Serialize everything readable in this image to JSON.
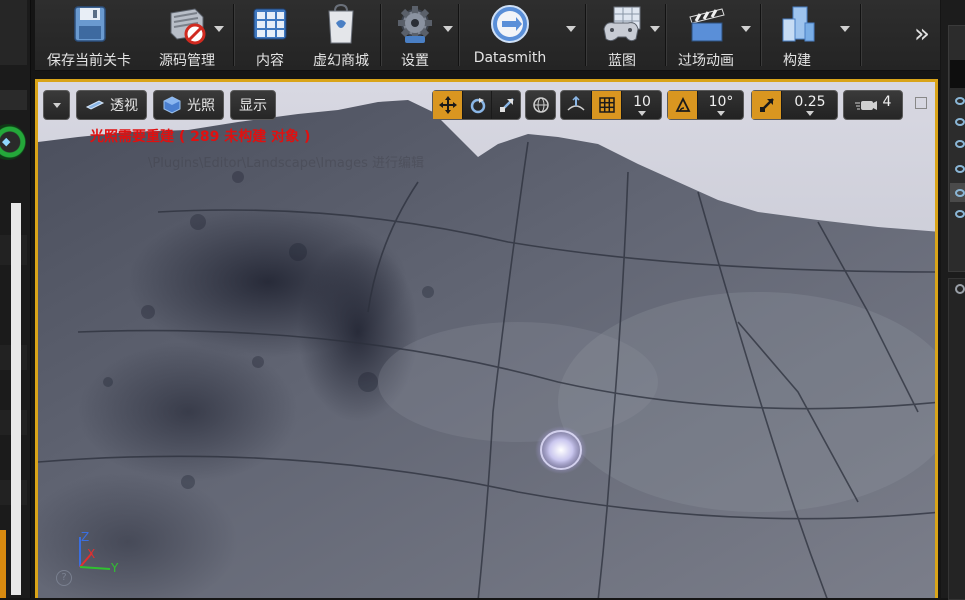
{
  "toolbar": {
    "items": [
      {
        "label": "保存当前关卡",
        "icon": "save-icon"
      },
      {
        "label": "源码管理",
        "icon": "source-control-icon"
      },
      {
        "label": "内容",
        "icon": "content-icon"
      },
      {
        "label": "虚幻商城",
        "icon": "marketplace-icon"
      },
      {
        "label": "设置",
        "icon": "settings-icon"
      },
      {
        "label": "Datasmith",
        "icon": "datasmith-icon"
      },
      {
        "label": "蓝图",
        "icon": "blueprint-icon"
      },
      {
        "label": "过场动画",
        "icon": "cinematics-icon"
      },
      {
        "label": "构建",
        "icon": "build-icon"
      }
    ],
    "more_icon": "double-chevron-right-icon",
    "more_glyph": "»"
  },
  "viewport": {
    "perspective_label": "透视",
    "lighting_label": "光照",
    "show_label": "显示",
    "grid_snap_value": "10",
    "rotation_snap_value": "10°",
    "scale_snap_value": "0.25",
    "camera_speed_value": "4",
    "warning_text": "光照需要重建 ( 289 未构建 对象 )",
    "ghost_text": "\\Plugins\\Editor\\Landscape\\Images 进行编辑",
    "axis_labels": {
      "z": "Z",
      "x": "X",
      "y": "Y"
    },
    "border_color": "#d9a419",
    "warning_color": "#e01010",
    "accent_orange": "#d99620"
  }
}
